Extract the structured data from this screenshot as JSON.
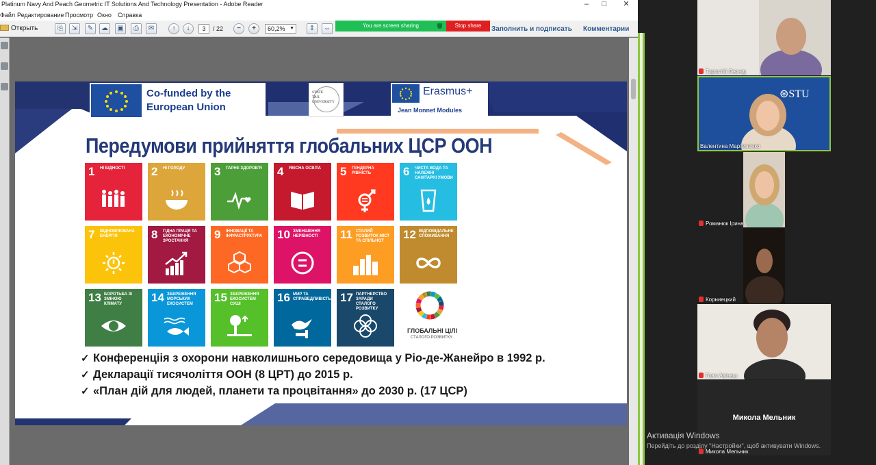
{
  "window": {
    "title": "Platinum Navy And Peach Geometric IT Solutions And Technology Presentation - Adobe Reader"
  },
  "menu": [
    "Файл",
    "Редактирование",
    "Просмотр",
    "Окно",
    "Справка"
  ],
  "toolbar": {
    "open_label": "Открыть",
    "page_current": "3",
    "page_total": "/ 22",
    "zoom": "60,2%",
    "sign_label": "Заполнить и подписать",
    "comments_label": "Комментарии"
  },
  "screen_share": {
    "banner": "You are screen sharing",
    "stop": "Stop share"
  },
  "slide": {
    "eu_funding": "Co-funded by the European Union",
    "university": [
      "STATE",
      "TAX",
      "UNIVERSITY"
    ],
    "erasmus": "Erasmus+",
    "jean_monnet": "Jean Monnet Modules",
    "title": "Передумови прийняття глобальних ЦСР ООН",
    "sdgs": [
      {
        "num": "1",
        "label": "Ні бідності",
        "color": "#e5243b"
      },
      {
        "num": "2",
        "label": "Ні голоду",
        "color": "#dda63a"
      },
      {
        "num": "3",
        "label": "Гарне здоров'я",
        "color": "#4c9f38"
      },
      {
        "num": "4",
        "label": "Якісна освіта",
        "color": "#c5192d"
      },
      {
        "num": "5",
        "label": "Гендерна рівність",
        "color": "#ff3a21"
      },
      {
        "num": "6",
        "label": "Чиста вода та належні санітарні умови",
        "color": "#26bde2"
      },
      {
        "num": "7",
        "label": "Відновлювана енергія",
        "color": "#fcc30b"
      },
      {
        "num": "8",
        "label": "Гідна праця та економічне зростання",
        "color": "#a21942"
      },
      {
        "num": "9",
        "label": "Інновації та інфраструктура",
        "color": "#fd6925"
      },
      {
        "num": "10",
        "label": "Зменшення нерівності",
        "color": "#dd1367"
      },
      {
        "num": "11",
        "label": "Сталий розвиток міст та спільнот",
        "color": "#fd9d24"
      },
      {
        "num": "12",
        "label": "Відповідальне споживання",
        "color": "#bf8b2e"
      },
      {
        "num": "13",
        "label": "Боротьба зі зміною клімату",
        "color": "#3f7e44"
      },
      {
        "num": "14",
        "label": "Збереження морських екосистем",
        "color": "#0a97d9"
      },
      {
        "num": "15",
        "label": "Збереження екосистем суші",
        "color": "#56c02b"
      },
      {
        "num": "16",
        "label": "Мир та справедливість",
        "color": "#00689d"
      },
      {
        "num": "17",
        "label": "Партнерство заради сталого розвитку",
        "color": "#19486a"
      }
    ],
    "global_goals": "ГЛОБАЛЬНІ ЦІЛІ",
    "global_goals_sub": "СТАЛОГО РОЗВИТКУ",
    "bullets": [
      "Конференціія з охорони навколишнього середовища у Ріо-де-Жанейро в 1992 р.",
      "Декларації тисячоліття ООН (8 ЦРТ) до 2015 р.",
      "«План дій для людей, планети та процвітання» до 2030 р. (17 ЦСР)"
    ]
  },
  "participants": [
    {
      "name": "Торохтій Леонід"
    },
    {
      "name": "Валентина Мартиненко"
    },
    {
      "name": "Романюк Ірина"
    },
    {
      "name": "Корниецкий"
    },
    {
      "name": "Гоял Авінаш"
    },
    {
      "name": "Микола Мельник",
      "big_name": "Микола Мельник"
    }
  ],
  "windows_activation": {
    "title": "Активація Windows",
    "subtitle": "Перейдіть до розділу \"Настройки\", щоб активувати Windows."
  }
}
